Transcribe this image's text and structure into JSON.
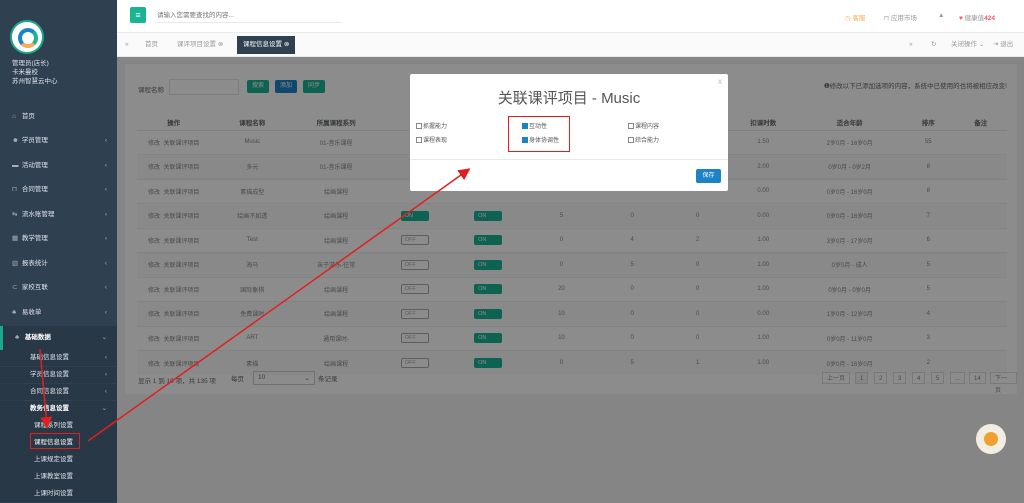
{
  "user": {
    "name": "管理员(店长)",
    "school": "卡米曼校",
    "org": "苏州智慧云中心"
  },
  "sidebar": {
    "items": [
      {
        "label": "首页",
        "icon": "home-icon"
      },
      {
        "label": "学员管理",
        "icon": "students-icon"
      },
      {
        "label": "活动管理",
        "icon": "activity-icon"
      },
      {
        "label": "合同管理",
        "icon": "contract-icon"
      },
      {
        "label": "流水账管理",
        "icon": "ledger-icon"
      },
      {
        "label": "教学管理",
        "icon": "teaching-icon"
      },
      {
        "label": "报表统计",
        "icon": "chart-icon"
      },
      {
        "label": "家校互联",
        "icon": "link-icon"
      },
      {
        "label": "易收单",
        "icon": "receipt-icon"
      },
      {
        "label": "基础数据",
        "icon": "data-icon"
      }
    ],
    "sub": [
      "基础信息设置",
      "学员信息设置",
      "合同信息设置",
      "教务信息设置"
    ],
    "sub2": [
      "课程系列设置",
      "课程信息设置",
      "上课规定设置",
      "上课教室设置",
      "上课时间设置"
    ]
  },
  "topbar": {
    "search_placeholder": "请输入您需要查找的内容...",
    "service": "客服",
    "market": "应用市场",
    "health": "健康值",
    "health_value": "424"
  },
  "tabs": [
    "首页",
    "课评项目设置",
    "课程信息设置"
  ],
  "tab_right": {
    "close": "关闭操作",
    "exit": "退出"
  },
  "filter": {
    "label": "课程名称",
    "search": "搜索",
    "add": "添加",
    "sync": "同步"
  },
  "notice": "❶修改以下已添加选项的内容，系统中已使用的也将被相应改变!",
  "table": {
    "headers": [
      "操作",
      "课程名称",
      "所属课程系列",
      "",
      "",
      "",
      "",
      "",
      "扣课时数",
      "适合年龄",
      "排序",
      "备注"
    ],
    "rows": [
      {
        "edit": "修改",
        "link": "关联课评项目",
        "name": "Music",
        "series": "01-音乐课程",
        "hours": "1.50",
        "age": "2岁0月 - 16岁0月",
        "sort": "55"
      },
      {
        "edit": "修改",
        "link": "关联课评项目",
        "name": "多元",
        "series": "01-音乐课程",
        "hours": "2.00",
        "age": "0岁0月 - 0岁2月",
        "sort": "8"
      },
      {
        "edit": "修改",
        "link": "关联课评项目",
        "name": "素描成型",
        "series": "绘画课程",
        "hours": "0.00",
        "age": "0岁0月 - 16岁0月",
        "sort": "8"
      },
      {
        "edit": "修改",
        "link": "关联课评项目",
        "name": "绘画不如透",
        "series": "绘画课程",
        "t1": "ON",
        "t2": "ON",
        "a": "5",
        "b": "0",
        "c": "0",
        "hours": "0.00",
        "age": "0岁0月 - 16岁0月",
        "sort": "7"
      },
      {
        "edit": "修改",
        "link": "关联课评项目",
        "name": "Test",
        "series": "绘画课程",
        "t1": "OFF",
        "t2": "ON",
        "a": "0",
        "b": "4",
        "c": "2",
        "hours": "1.00",
        "age": "3岁0月 - 17岁0月",
        "sort": "6"
      },
      {
        "edit": "修改",
        "link": "关联课评项目",
        "name": "海马",
        "series": "亲子游乐-往常",
        "t1": "OFF",
        "t2": "ON",
        "a": "0",
        "b": "5",
        "c": "0",
        "hours": "1.00",
        "age": "0岁0月 - 成人",
        "sort": "5"
      },
      {
        "edit": "修改",
        "link": "关联课评项目",
        "name": "国际象棋",
        "series": "绘画课程",
        "t1": "OFF",
        "t2": "ON",
        "a": "20",
        "b": "0",
        "c": "0",
        "hours": "1.00",
        "age": "0岁0月 - 0岁0月",
        "sort": "5"
      },
      {
        "edit": "修改",
        "link": "关联课评项目",
        "name": "免费课时",
        "series": "绘画课程",
        "t1": "OFF",
        "t2": "ON",
        "a": "10",
        "b": "0",
        "c": "0",
        "hours": "0.00",
        "age": "1岁0月 - 12岁0月",
        "sort": "4"
      },
      {
        "edit": "修改",
        "link": "关联课评项目",
        "name": "ART",
        "series": "通用课时-",
        "t1": "OFF",
        "t2": "ON",
        "a": "10",
        "b": "0",
        "c": "0",
        "hours": "1.00",
        "age": "0岁0月 - 11岁0月",
        "sort": "3"
      },
      {
        "edit": "修改",
        "link": "关联课评项目",
        "name": "素描",
        "series": "绘画课程",
        "t1": "OFF",
        "t2": "ON",
        "a": "0",
        "b": "5",
        "c": "1",
        "hours": "1.00",
        "age": "0岁0月 - 16岁0月",
        "sort": "2"
      }
    ]
  },
  "footer": {
    "info": "显示 1 到 10 项，共 135 项",
    "per_page_label": "每页",
    "per_page": "10",
    "unit": "条记录"
  },
  "pager": [
    "上一页",
    "1",
    "2",
    "3",
    "4",
    "5",
    "...",
    "14",
    "下一页"
  ],
  "modal": {
    "title": "关联课评项目 - Music",
    "close": "x",
    "options": [
      {
        "label": "抓握能力",
        "checked": false
      },
      {
        "label": "互动性",
        "checked": true
      },
      {
        "label": "课程内容",
        "checked": false
      },
      {
        "label": "课程表现",
        "checked": false
      },
      {
        "label": "身体协调性",
        "checked": true
      },
      {
        "label": "综合能力",
        "checked": false
      }
    ],
    "save": "保存"
  },
  "colors": {
    "accent": "#1ab394",
    "primary": "#1c84c6",
    "sidebar": "#2f4050",
    "highlight": "#e02020"
  }
}
